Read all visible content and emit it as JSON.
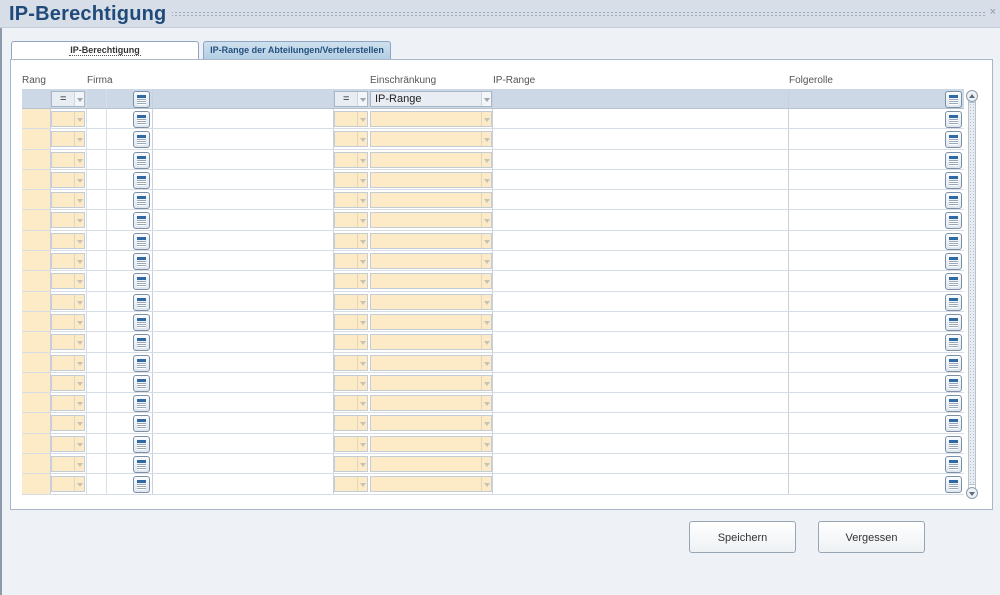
{
  "window": {
    "title": "IP-Berechtigung",
    "close_label": "×"
  },
  "tabs": [
    {
      "label": "IP-Berechtigung",
      "active": true
    },
    {
      "label": "IP-Range der Abteilungen/Vertelerstellen",
      "active": false
    }
  ],
  "columns": {
    "rang": "Rang",
    "firma": "Firma",
    "einschraenkung": "Einschränkung",
    "ip_range": "IP-Range",
    "folgerolle": "Folgerolle"
  },
  "filter_row": {
    "operator1": "=",
    "operator2": "=",
    "einschraenkung_value": "IP-Range"
  },
  "row_count": 19,
  "buttons": {
    "save": "Speichern",
    "forget": "Vergessen"
  },
  "icons": {
    "lov": "list-of-values-icon",
    "dropdown": "chevron-down-icon",
    "scroll_up": "scroll-up-icon",
    "scroll_down": "scroll-down-icon"
  },
  "colors": {
    "title": "#1f4a7a",
    "required_field": "#fcebc6",
    "filter_row": "#ccd8e6",
    "active_tab": "#ffffff",
    "inactive_tab": "#b3cde3"
  }
}
